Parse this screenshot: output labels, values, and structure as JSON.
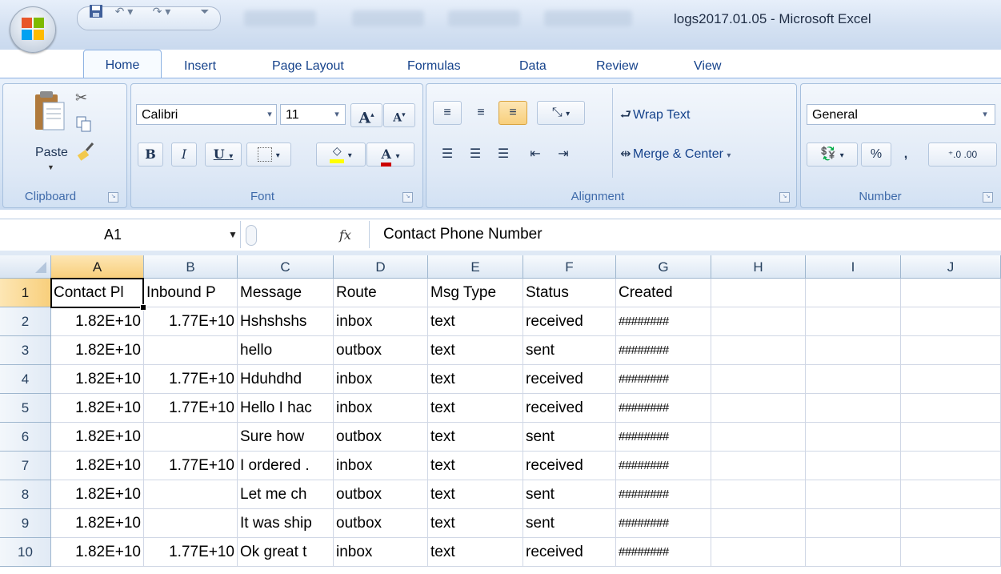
{
  "window": {
    "title": "logs2017.01.05 - Microsoft Excel"
  },
  "quick_access": {
    "icons": [
      "save-icon",
      "undo-icon",
      "redo-icon",
      "customize-icon"
    ]
  },
  "tabs": [
    "Home",
    "Insert",
    "Page Layout",
    "Formulas",
    "Data",
    "Review",
    "View"
  ],
  "ribbon": {
    "clipboard": {
      "label": "Clipboard",
      "paste_label": "Paste"
    },
    "font": {
      "label": "Font",
      "font_name": "Calibri",
      "font_size": "11",
      "bold": "B",
      "italic": "I",
      "underline": "U",
      "grow": "A",
      "shrink": "A",
      "font_color": "A",
      "underline_color": "#cc0000",
      "highlight_color": "#ffff00"
    },
    "alignment": {
      "label": "Alignment",
      "wrap_text": "Wrap Text",
      "merge_center": "Merge & Center"
    },
    "number": {
      "label": "Number",
      "format": "General",
      "percent": "%",
      "comma": ","
    }
  },
  "formula_bar": {
    "name_box": "A1",
    "fx": "fx",
    "value": "Contact Phone Number"
  },
  "sheet": {
    "columns": [
      "A",
      "B",
      "C",
      "D",
      "E",
      "F",
      "G",
      "H",
      "I",
      "J"
    ],
    "selected_column": "A",
    "selected_row": "1",
    "rows": [
      {
        "num": "1",
        "cells": [
          "Contact Pl",
          "Inbound P",
          "Message",
          "Route",
          "Msg Type",
          "Status",
          "Created"
        ]
      },
      {
        "num": "2",
        "cells": [
          "1.82E+10",
          "1.77E+10",
          "Hshshshs",
          "inbox",
          "text",
          "received",
          "########"
        ]
      },
      {
        "num": "3",
        "cells": [
          "1.82E+10",
          "",
          "hello",
          "outbox",
          "text",
          "sent",
          "########"
        ]
      },
      {
        "num": "4",
        "cells": [
          "1.82E+10",
          "1.77E+10",
          "Hduhdhd",
          "inbox",
          "text",
          "received",
          "########"
        ]
      },
      {
        "num": "5",
        "cells": [
          "1.82E+10",
          "1.77E+10",
          "Hello I hac",
          "inbox",
          "text",
          "received",
          "########"
        ]
      },
      {
        "num": "6",
        "cells": [
          "1.82E+10",
          "",
          "Sure how",
          "outbox",
          "text",
          "sent",
          "########"
        ]
      },
      {
        "num": "7",
        "cells": [
          "1.82E+10",
          "1.77E+10",
          "I ordered .",
          "inbox",
          "text",
          "received",
          "########"
        ]
      },
      {
        "num": "8",
        "cells": [
          "1.82E+10",
          "",
          "Let me ch",
          "outbox",
          "text",
          "sent",
          "########"
        ]
      },
      {
        "num": "9",
        "cells": [
          "1.82E+10",
          "",
          "It was ship",
          "outbox",
          "text",
          "sent",
          "########"
        ]
      },
      {
        "num": "10",
        "cells": [
          "1.82E+10",
          "1.77E+10",
          "Ok great t",
          "inbox",
          "text",
          "received",
          "########"
        ]
      }
    ]
  }
}
